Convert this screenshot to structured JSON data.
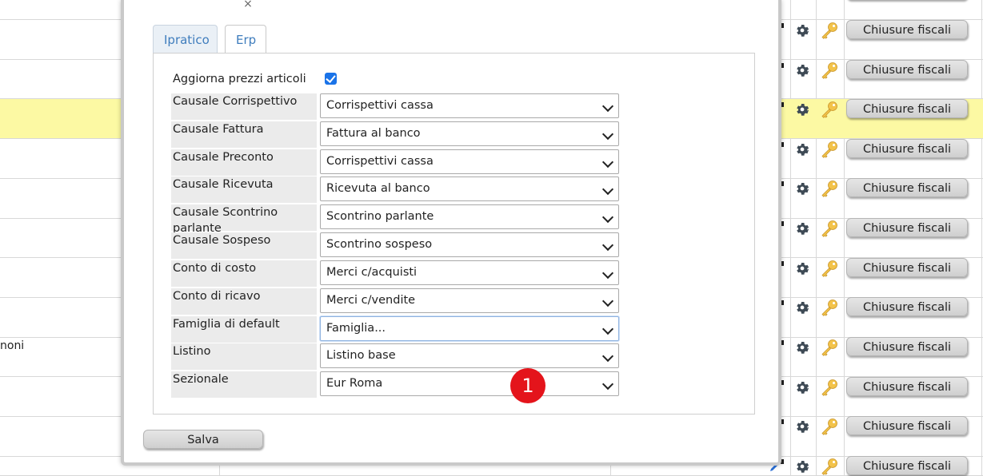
{
  "background": {
    "rows": [
      {
        "left_text": "",
        "button_label": "Chiusure fiscali",
        "highlight": false
      },
      {
        "left_text": "",
        "button_label": "Chiusure fiscali",
        "highlight": false
      },
      {
        "left_text": "",
        "button_label": "Chiusure fiscali",
        "highlight": false
      },
      {
        "left_text": "",
        "button_label": "Chiusure fiscali",
        "highlight": true
      },
      {
        "left_text": "",
        "button_label": "Chiusure fiscali",
        "highlight": false
      },
      {
        "left_text": "",
        "button_label": "Chiusure fiscali",
        "highlight": false
      },
      {
        "left_text": "",
        "button_label": "Chiusure fiscali",
        "highlight": false
      },
      {
        "left_text": "",
        "button_label": "Chiusure fiscali",
        "highlight": false
      },
      {
        "left_text": "",
        "button_label": "Chiusure fiscali",
        "highlight": false
      },
      {
        "left_text": "noni",
        "button_label": "Chiusure fiscali",
        "highlight": false
      },
      {
        "left_text": "",
        "button_label": "Chiusure fiscali",
        "highlight": false
      },
      {
        "left_text": "",
        "button_label": "Chiusure fiscali",
        "highlight": false
      }
    ],
    "highlight_color": "#fcf9a3"
  },
  "modal": {
    "close_label": "×",
    "tabs": [
      {
        "label": "Ipratico",
        "active": false
      },
      {
        "label": "Erp",
        "active": true
      }
    ],
    "checkbox_row": {
      "label": "Aggiorna prezzi articoli",
      "checked": true
    },
    "fields": [
      {
        "label": "Causale Corrispettivo",
        "value": "Corrispettivi cassa"
      },
      {
        "label": "Causale Fattura",
        "value": "Fattura al banco"
      },
      {
        "label": "Causale Preconto",
        "value": "Corrispettivi cassa"
      },
      {
        "label": "Causale Ricevuta",
        "value": "Ricevuta al banco"
      },
      {
        "label": "Causale Scontrino parlante",
        "value": "Scontrino parlante"
      },
      {
        "label": "Causale Sospeso",
        "value": "Scontrino sospeso"
      },
      {
        "label": "Conto di costo",
        "value": "Merci c/acquisti"
      },
      {
        "label": "Conto di ricavo",
        "value": "Merci c/vendite"
      },
      {
        "label": "Famiglia di default",
        "value": "Famiglia..."
      },
      {
        "label": "Listino",
        "value": "Listino base"
      },
      {
        "label": "Sezionale",
        "value": "Eur Roma"
      }
    ],
    "save_label": "Salva",
    "badge": "1"
  },
  "colors": {
    "accent": "#1a73e8",
    "tab_text": "#3f7dbd",
    "badge": "#e4141b",
    "key_icon": "#f3c34a",
    "gear_icon": "#3e4a55"
  },
  "icons": {
    "gear": "gear-icon",
    "key": "key-icon",
    "check": "check-icon",
    "chevron": "chevron-down-icon",
    "close": "close-icon",
    "pencil": "pencil-icon"
  }
}
